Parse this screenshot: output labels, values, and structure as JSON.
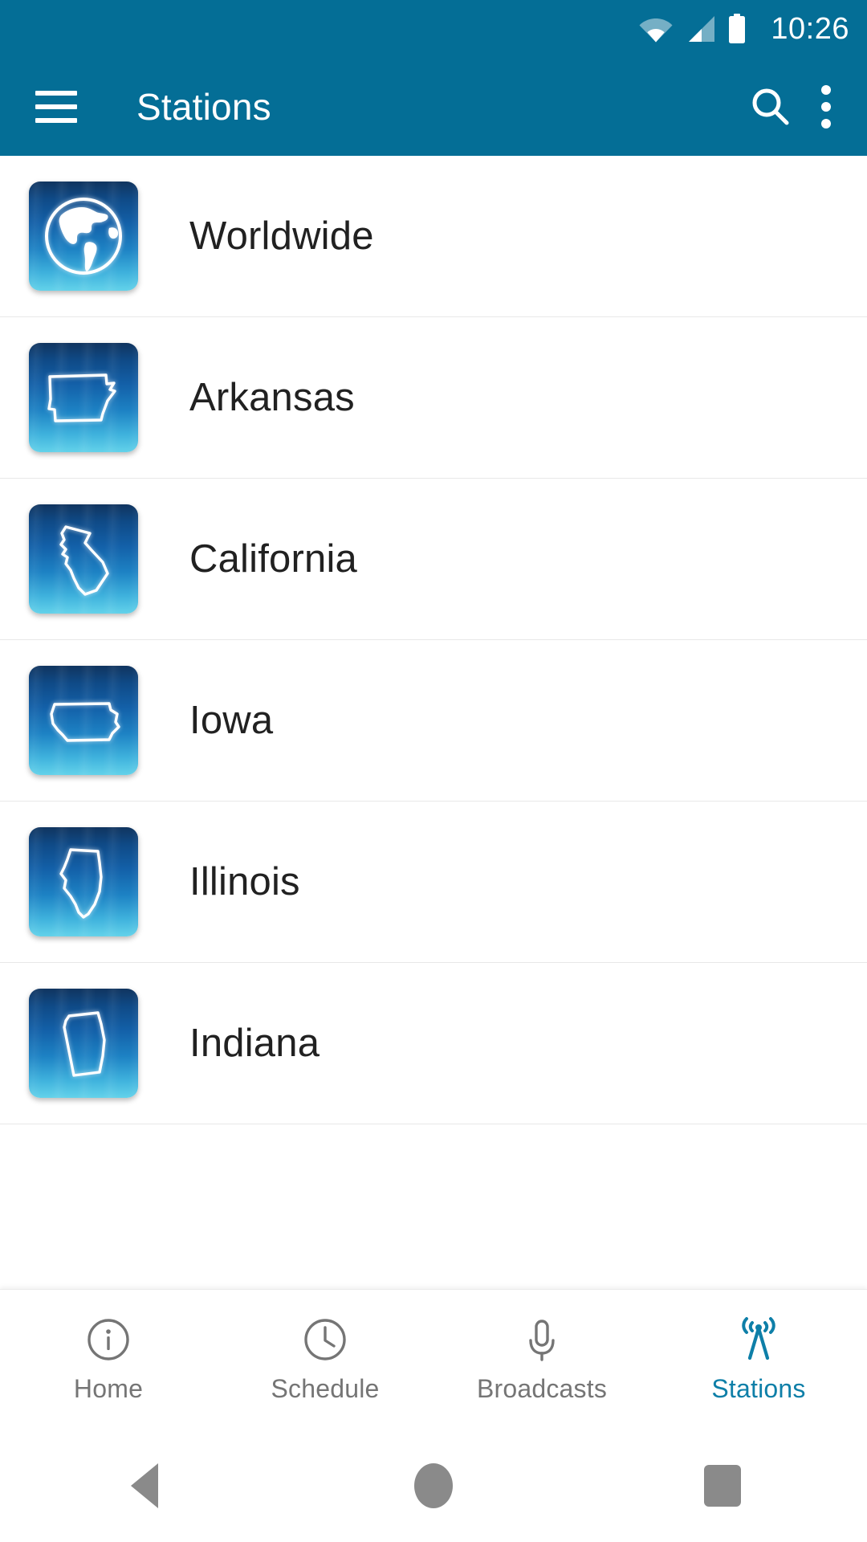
{
  "theme": {
    "brand_color": "#046E96",
    "accent_color": "#0E7FA8",
    "text_primary": "#212121",
    "text_muted": "#757575",
    "tile_gradient_top": "#10345f",
    "tile_gradient_bottom": "#63d2ea",
    "divider_color": "#e8e8e8",
    "background": "#ffffff"
  },
  "status_bar": {
    "time": "10:26",
    "icons": [
      "wifi-icon",
      "cellular-signal-icon",
      "battery-icon"
    ],
    "wifi_level": "partial",
    "signal_level": "partial",
    "battery_level": "full"
  },
  "app_bar": {
    "title": "Stations",
    "menu_icon": "hamburger-menu-icon",
    "actions": [
      {
        "name": "search-icon",
        "label": "Search"
      },
      {
        "name": "overflow-menu-icon",
        "label": "More options"
      }
    ]
  },
  "station_list": {
    "items": [
      {
        "label": "Worldwide",
        "icon": "globe-icon"
      },
      {
        "label": "Arkansas",
        "icon": "state-outline-arkansas-icon"
      },
      {
        "label": "California",
        "icon": "state-outline-california-icon"
      },
      {
        "label": "Iowa",
        "icon": "state-outline-iowa-icon"
      },
      {
        "label": "Illinois",
        "icon": "state-outline-illinois-icon"
      },
      {
        "label": "Indiana",
        "icon": "state-outline-indiana-icon"
      }
    ]
  },
  "tab_bar": {
    "active_index": 3,
    "tabs": [
      {
        "label": "Home",
        "icon": "info-circle-icon"
      },
      {
        "label": "Schedule",
        "icon": "clock-icon"
      },
      {
        "label": "Broadcasts",
        "icon": "microphone-icon"
      },
      {
        "label": "Stations",
        "icon": "broadcast-tower-icon"
      }
    ]
  },
  "system_nav": {
    "buttons": [
      {
        "name": "android-back-button",
        "label": "Back"
      },
      {
        "name": "android-home-button",
        "label": "Home"
      },
      {
        "name": "android-recents-button",
        "label": "Recents"
      }
    ]
  }
}
